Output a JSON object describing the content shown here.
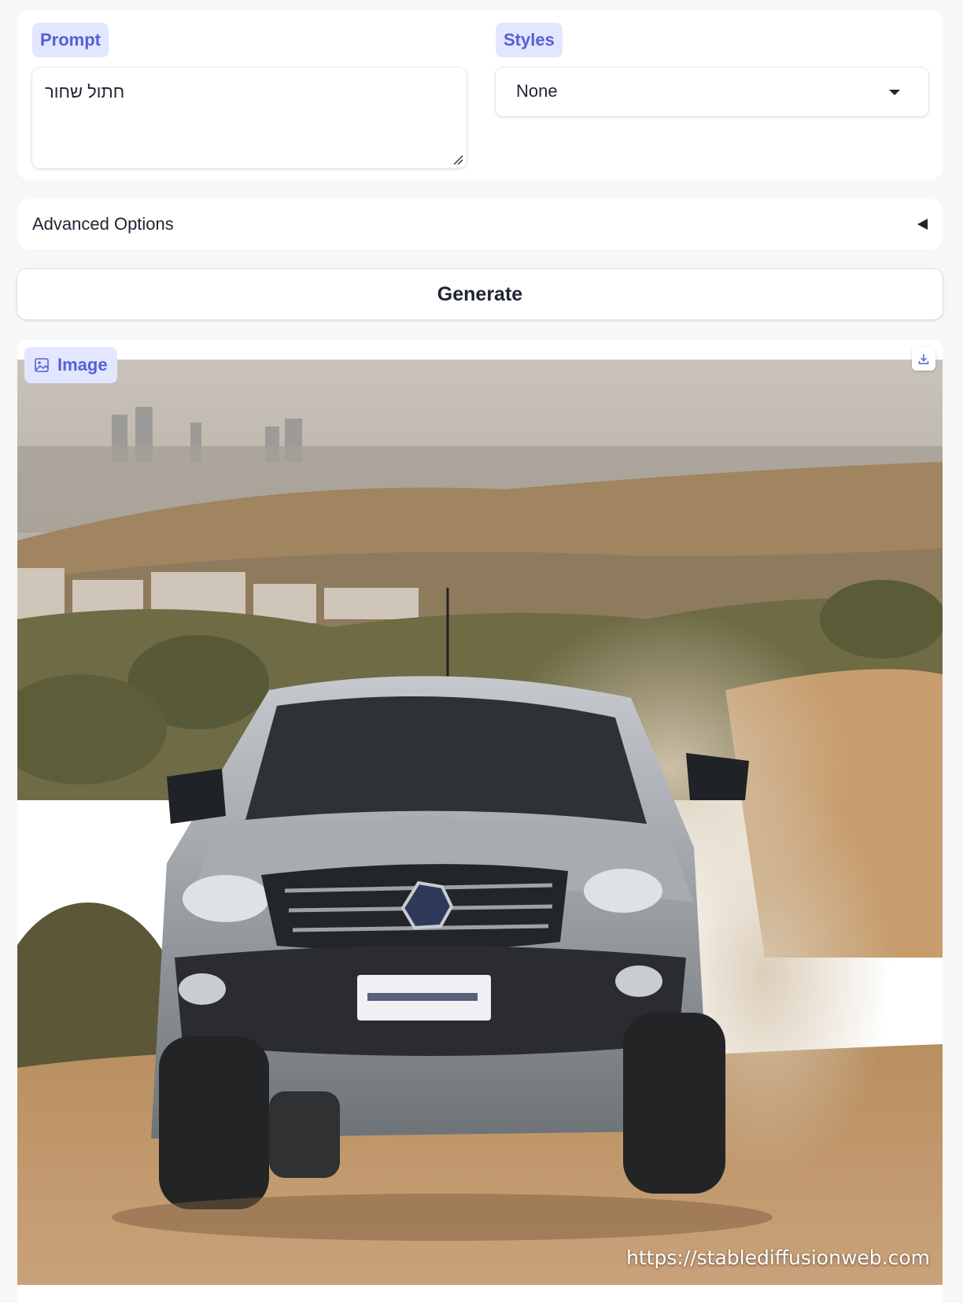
{
  "prompt": {
    "label": "Prompt",
    "value": "חתול שחור"
  },
  "styles": {
    "label": "Styles",
    "selected": "None"
  },
  "advanced": {
    "label": "Advanced Options",
    "expanded": false
  },
  "generate": {
    "label": "Generate"
  },
  "output": {
    "label": "Image",
    "watermark": "https://stablediffusionweb.com",
    "icons": {
      "label_icon": "image-icon",
      "download_icon": "download-icon"
    }
  },
  "colors": {
    "accent": "#5560d6",
    "chip_bg": "#e3e6ff",
    "page_bg": "#f6f7f9"
  }
}
